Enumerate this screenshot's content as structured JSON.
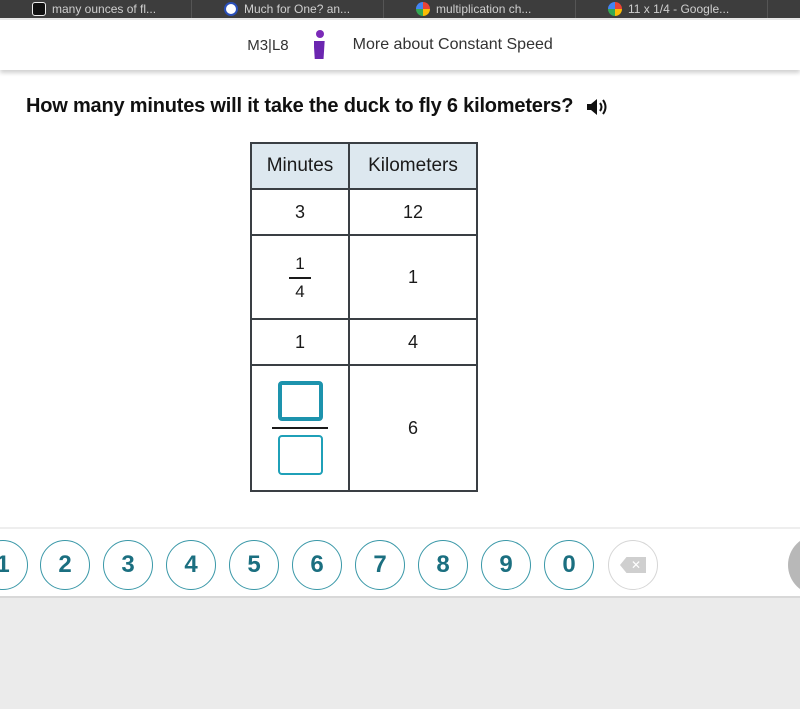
{
  "browser": {
    "tabs": [
      {
        "label": "many ounces of fl...",
        "icon": "bold-b-icon",
        "favicon": "fav-b"
      },
      {
        "label": "Much for One? an...",
        "icon": "check-shield-icon",
        "favicon": "fav-v"
      },
      {
        "label": "multiplication ch...",
        "icon": "google-icon",
        "favicon": "fav-g"
      },
      {
        "label": "11 x 1/4 - Google...",
        "icon": "google-icon",
        "favicon": "fav-g"
      }
    ]
  },
  "header": {
    "lesson": "M3|L8",
    "logo": "brand-logo-icon",
    "title": "More about Constant Speed"
  },
  "question": {
    "text": "How many minutes will it take the duck to fly 6 kilometers?",
    "audio_icon": "speaker-icon"
  },
  "table": {
    "headers": [
      "Minutes",
      "Kilometers"
    ],
    "rows": [
      {
        "minutes": "3",
        "kilometers": "12"
      },
      {
        "minutes_fraction": {
          "numerator": "1",
          "denominator": "4"
        },
        "kilometers": "1"
      },
      {
        "minutes": "1",
        "kilometers": "4"
      },
      {
        "minutes_input": {
          "numerator": "",
          "denominator": ""
        },
        "kilometers": "6"
      }
    ]
  },
  "keypad": {
    "keys": [
      "1",
      "2",
      "3",
      "4",
      "5",
      "6",
      "7",
      "8",
      "9",
      "0"
    ],
    "backspace": "backspace-icon"
  },
  "colors": {
    "accent": "#1d93ad",
    "key_text": "#1b6f80",
    "header_cell": "#dde8ef",
    "brand": "#6b26b0"
  }
}
